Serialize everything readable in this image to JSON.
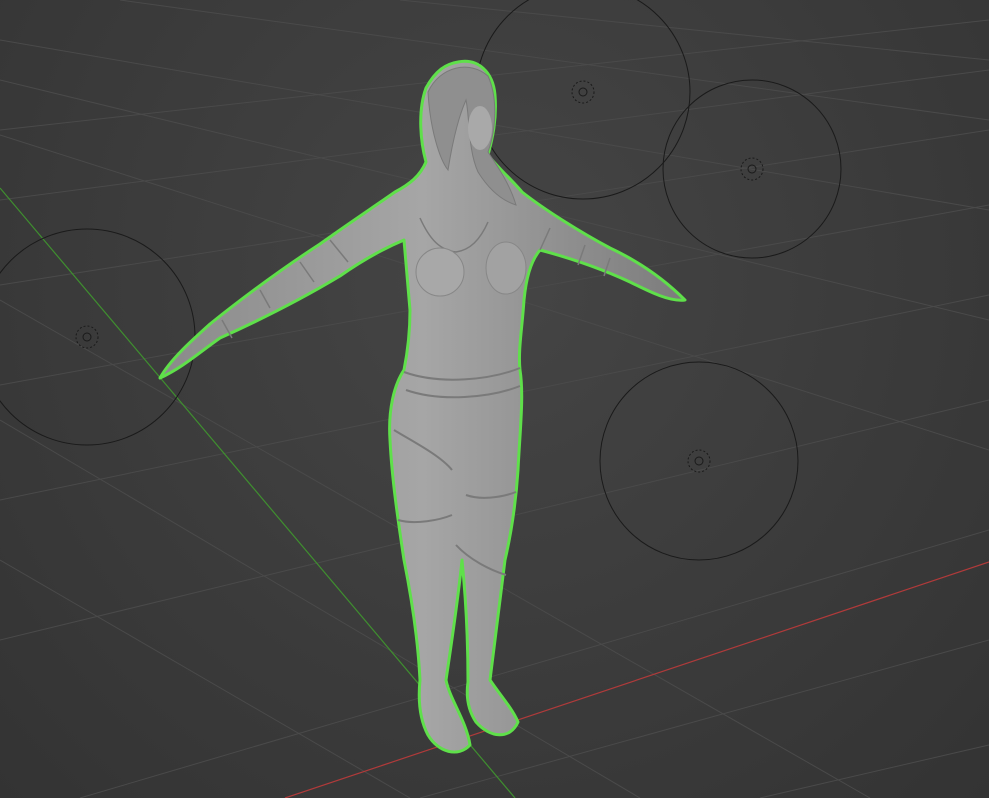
{
  "viewport": {
    "background": "#3d3d3d",
    "grid_color": "#4a4a4a",
    "x_axis_color": "#b03a3a",
    "y_axis_color": "#3f8f2f",
    "selection_outline_color": "#5fe04a",
    "mesh_color": "#9a9a9a",
    "light_gizmo_color": "#1a1a1a"
  },
  "objects": {
    "character": {
      "icon": "character-mesh",
      "selected": true
    },
    "lights": [
      {
        "icon": "light-icon"
      },
      {
        "icon": "light-icon"
      },
      {
        "icon": "light-icon"
      },
      {
        "icon": "light-icon"
      }
    ]
  }
}
